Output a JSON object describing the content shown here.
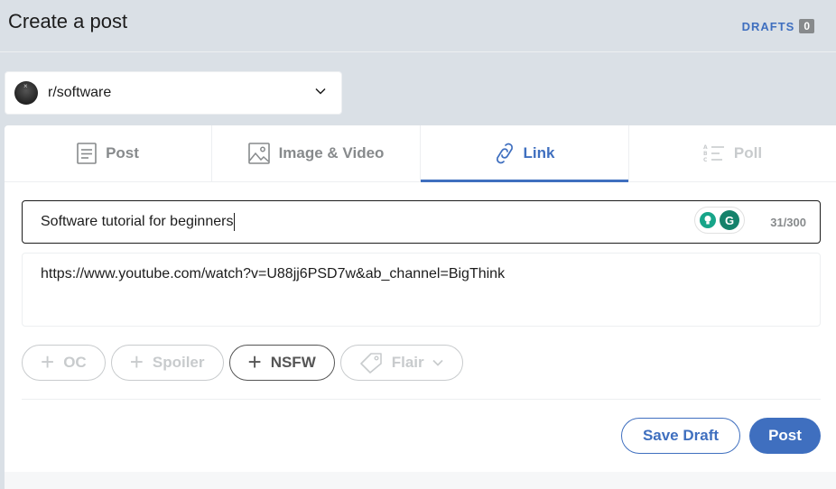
{
  "header": {
    "title": "Create a post",
    "drafts_label": "DRAFTS",
    "drafts_count": "0"
  },
  "community": {
    "name": "r/software",
    "avatar_icon": "community-avatar",
    "chevron_icon": "chevron-down-icon"
  },
  "tabs": [
    {
      "label": "Post",
      "icon": "document-icon",
      "active": false
    },
    {
      "label": "Image & Video",
      "icon": "image-icon",
      "active": false
    },
    {
      "label": "Link",
      "icon": "link-icon",
      "active": true
    },
    {
      "label": "Poll",
      "icon": "poll-icon",
      "active": false,
      "disabled": true
    }
  ],
  "title_field": {
    "value": "Software tutorial for beginners",
    "char_count": "31/300"
  },
  "grammarly": {
    "g_label": "G"
  },
  "url_field": {
    "value": "https://www.youtube.com/watch?v=U88jj6PSD7w&ab_channel=BigThink"
  },
  "tags": [
    {
      "label": "OC"
    },
    {
      "label": "Spoiler"
    },
    {
      "label": "NSFW"
    },
    {
      "label": "Flair"
    }
  ],
  "actions": {
    "save_draft": "Save Draft",
    "post": "Post"
  },
  "colors": {
    "accent": "#3f6fbf",
    "background": "#dae0e6",
    "muted": "#878a8c"
  }
}
